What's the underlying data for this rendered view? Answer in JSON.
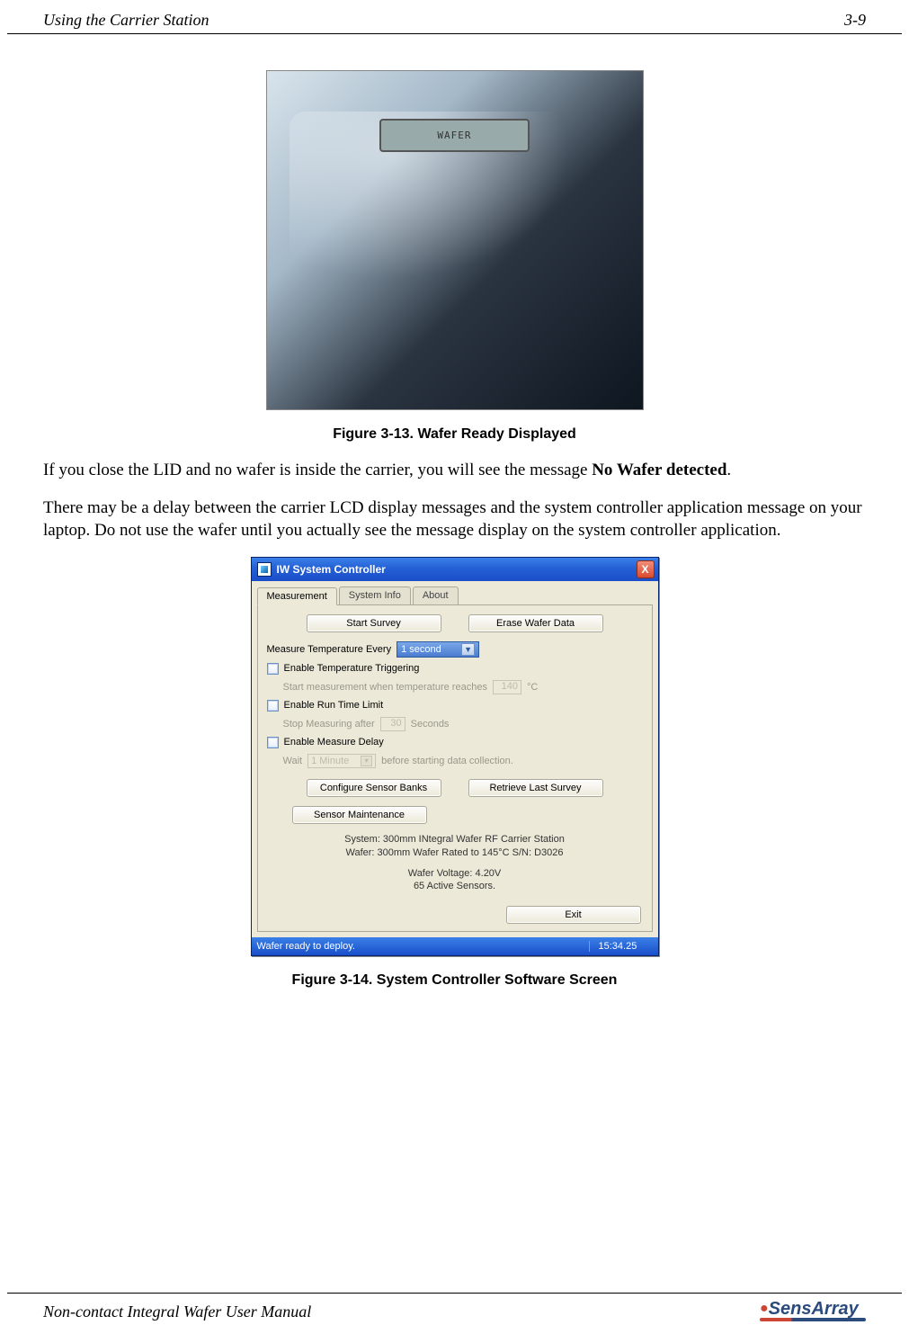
{
  "header": {
    "left": "Using the Carrier Station",
    "right": "3-9"
  },
  "figure1": {
    "caption": "Figure 3-13. Wafer Ready Displayed",
    "lcd_text": "WAFER"
  },
  "paragraphs": {
    "p1_a": "If you close the LID and no wafer is inside the carrier, you will see the message ",
    "p1_bold": "No Wafer detected",
    "p1_b": ".",
    "p2": "There may be a delay between the carrier LCD display messages and the system controller application message on your laptop. Do not use the wafer until you actually see the message display on the system controller application."
  },
  "app": {
    "title": "IW System Controller",
    "close": "X",
    "tabs": [
      "Measurement",
      "System Info",
      "About"
    ],
    "buttons": {
      "start_survey": "Start Survey",
      "erase": "Erase Wafer Data",
      "config_banks": "Configure Sensor Banks",
      "retrieve": "Retrieve Last Survey",
      "sensor_maint": "Sensor Maintenance",
      "exit": "Exit"
    },
    "measure_label": "Measure Temperature Every",
    "measure_value": "1 second",
    "temp_trigger": {
      "label": "Enable Temperature Triggering",
      "sub_a": "Start measurement when temperature reaches",
      "value": "140",
      "unit": "°C"
    },
    "runtime": {
      "label": "Enable Run Time Limit",
      "sub_a": "Stop Measuring after",
      "value": "30",
      "unit": "Seconds"
    },
    "delay": {
      "label": "Enable Measure Delay",
      "sub_a": "Wait",
      "value": "1 Minute",
      "sub_b": "before starting data collection."
    },
    "status_lines": [
      "System: 300mm INtegral Wafer RF Carrier Station",
      "Wafer: 300mm Wafer Rated to 145°C S/N: D3026",
      "Wafer Voltage: 4.20V",
      "65 Active Sensors."
    ],
    "statusbar": {
      "msg": "Wafer ready to deploy.",
      "time": "15:34.25"
    }
  },
  "figure2": {
    "caption": "Figure 3-14. System Controller Software Screen"
  },
  "footer": {
    "left": "Non-contact Integral Wafer User Manual",
    "logo_a": "Sens",
    "logo_b": "Array"
  }
}
